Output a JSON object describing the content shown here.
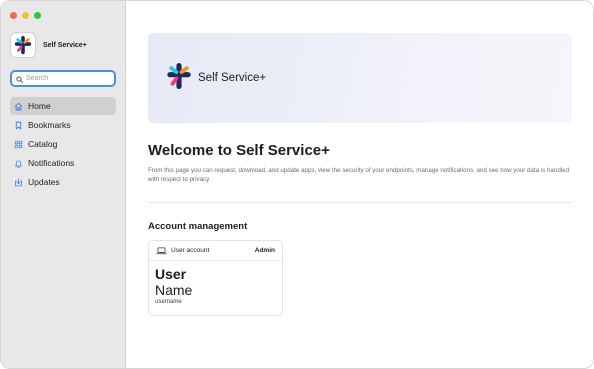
{
  "app": {
    "name": "Self Service+"
  },
  "sidebar": {
    "search": {
      "placeholder": "Search",
      "value": ""
    },
    "items": [
      {
        "label": "Home",
        "icon": "house-icon",
        "active": true
      },
      {
        "label": "Bookmarks",
        "icon": "bookmark-icon",
        "active": false
      },
      {
        "label": "Catalog",
        "icon": "grid-icon",
        "active": false
      },
      {
        "label": "Notifications",
        "icon": "bell-icon",
        "active": false
      },
      {
        "label": "Updates",
        "icon": "download-icon",
        "active": false
      }
    ]
  },
  "main": {
    "banner_title": "Self Service+",
    "welcome_title": "Welcome to Self Service+",
    "description": "From this page you can request, download, and update apps, view the security of your endpoints, manage notifications, and see how your data is handled with respect to privacy.",
    "section_title": "Account management",
    "account_card": {
      "label": "User account",
      "role": "Admin",
      "first_name": "User",
      "last_name": "Name",
      "username": "username"
    }
  },
  "colors": {
    "accent": "#4a90e2",
    "sidebar_bg": "#e8e8e8",
    "logo_cyan": "#2ec4e6",
    "logo_pink": "#e83e8c",
    "logo_orange": "#f7941d",
    "logo_navy": "#1f2a5c"
  }
}
